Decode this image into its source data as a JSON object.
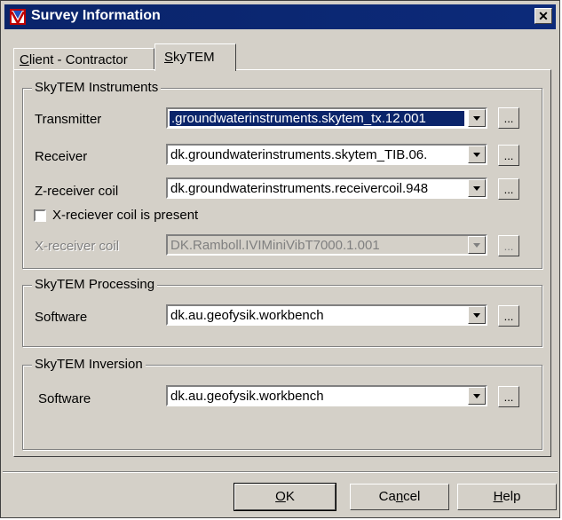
{
  "window": {
    "title": "Survey Information",
    "close_glyph": "✕"
  },
  "tabs": [
    {
      "label_pre": "",
      "accel": "C",
      "label_post": "lient - Contractor",
      "selected": false
    },
    {
      "label_pre": "",
      "accel": "S",
      "label_post": "kyTEM",
      "selected": true
    }
  ],
  "instruments": {
    "group_title": "SkyTEM Instruments",
    "transmitter_label": "Transmitter",
    "transmitter_value": ".groundwaterinstruments.skytem_tx.12.001",
    "receiver_label": "Receiver",
    "receiver_value": "dk.groundwaterinstruments.skytem_TIB.06.",
    "zcoil_label": "Z-receiver coil",
    "zcoil_value": "dk.groundwaterinstruments.receivercoil.948",
    "xcoil_checkbox_label": "X-reciever coil is present",
    "xcoil_checked": false,
    "xcoil_label": "X-receiver coil",
    "xcoil_value": "DK.Ramboll.IVIMiniVibT7000.1.001"
  },
  "processing": {
    "group_title": "SkyTEM Processing",
    "software_label": "Software",
    "software_value": "dk.au.geofysik.workbench"
  },
  "inversion": {
    "group_title": "SkyTEM Inversion",
    "software_label": "Software",
    "software_value": "dk.au.geofysik.workbench"
  },
  "browse_label": "...",
  "buttons": {
    "ok_accel": "O",
    "ok_rest": "K",
    "cancel_pre": "Ca",
    "cancel_accel": "n",
    "cancel_post": "cel",
    "help_accel": "H",
    "help_rest": "elp"
  },
  "colors": {
    "face": "#d4d0c8",
    "title_bar": "#0a246a",
    "selection": "#0a246a"
  }
}
